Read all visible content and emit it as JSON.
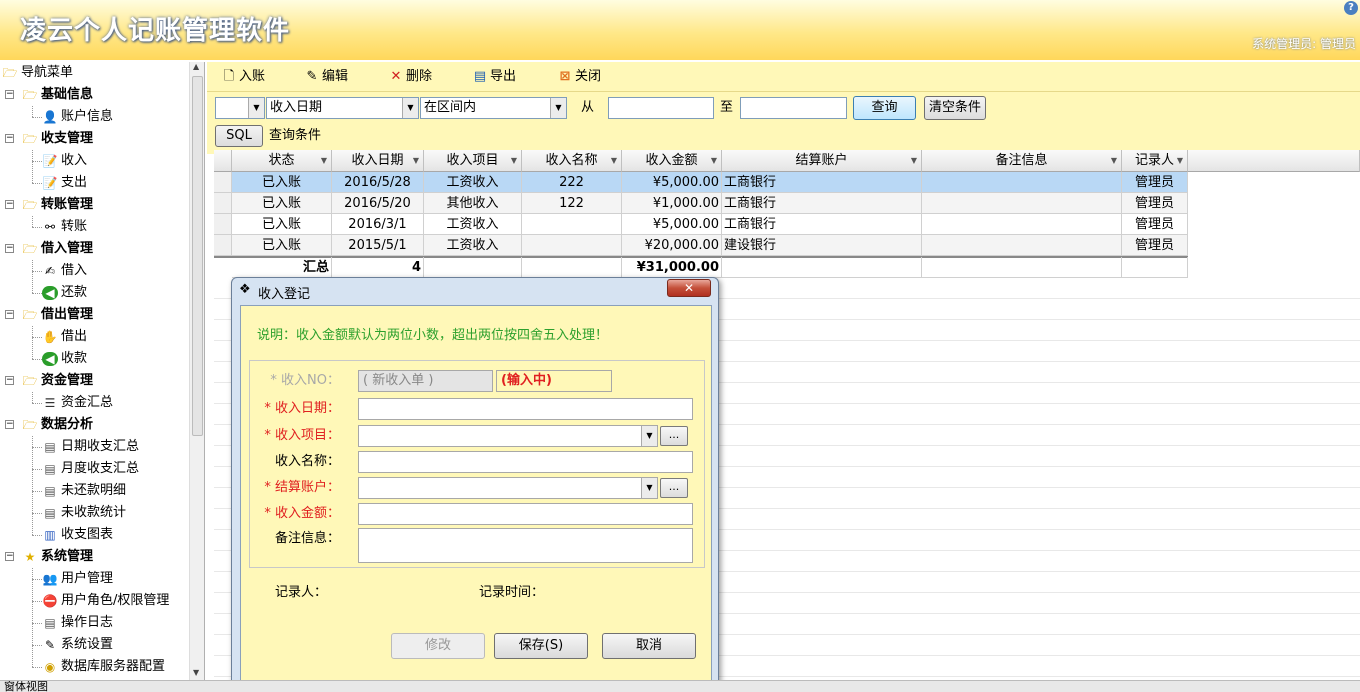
{
  "app": {
    "title": "凌云个人记账管理软件",
    "user_info": "系统管理员: 管理员",
    "help": "?"
  },
  "nav": {
    "root": "导航菜单",
    "groups": [
      {
        "label": "基础信息",
        "items": [
          "账户信息"
        ]
      },
      {
        "label": "收支管理",
        "items": [
          "收入",
          "支出"
        ]
      },
      {
        "label": "转账管理",
        "items": [
          "转账"
        ]
      },
      {
        "label": "借入管理",
        "items": [
          "借入",
          "还款"
        ]
      },
      {
        "label": "借出管理",
        "items": [
          "借出",
          "收款"
        ]
      },
      {
        "label": "资金管理",
        "items": [
          "资金汇总"
        ]
      },
      {
        "label": "数据分析",
        "items": [
          "日期收支汇总",
          "月度收支汇总",
          "未还款明细",
          "未收款统计",
          "收支图表"
        ]
      },
      {
        "label": "系统管理",
        "items": [
          "用户管理",
          "用户角色/权限管理",
          "操作日志",
          "系统设置",
          "数据库服务器配置"
        ]
      }
    ]
  },
  "toolbar": {
    "add": "入账",
    "edit": "编辑",
    "delete": "删除",
    "export": "导出",
    "close": "关闭"
  },
  "filter": {
    "field": "收入日期",
    "operator": "在区间内",
    "from_label": "从",
    "to_label": "至",
    "query": "查询",
    "clear": "清空条件",
    "sql": "SQL",
    "conditions": "查询条件"
  },
  "grid": {
    "columns": [
      "状态",
      "收入日期",
      "收入项目",
      "收入名称",
      "收入金额",
      "结算账户",
      "备注信息",
      "记录人"
    ],
    "rows": [
      [
        "已入账",
        "2016/5/28",
        "工资收入",
        "222",
        "¥5,000.00",
        "工商银行",
        "",
        "管理员"
      ],
      [
        "已入账",
        "2016/5/20",
        "其他收入",
        "122",
        "¥1,000.00",
        "工商银行",
        "",
        "管理员"
      ],
      [
        "已入账",
        "2016/3/1",
        "工资收入",
        "",
        "¥5,000.00",
        "工商银行",
        "",
        "管理员"
      ],
      [
        "已入账",
        "2015/5/1",
        "工资收入",
        "",
        "¥20,000.00",
        "建设银行",
        "",
        "管理员"
      ]
    ],
    "summary": {
      "label": "汇总",
      "count": "4",
      "total": "¥31,000.00"
    }
  },
  "dialog": {
    "title": "收入登记",
    "note": "说明：收入金额默认为两位小数，超出两位按四舍五入处理！",
    "no_label": "* 收入NO：",
    "no_value": "( 新收入单 )",
    "state": "(输入中)",
    "date_label": "* 收入日期：",
    "item_label": "* 收入项目：",
    "name_label": "收入名称：",
    "account_label": "* 结算账户：",
    "amount_label": "* 收入金额：",
    "remark_label": "备注信息：",
    "ellipsis": "...",
    "recorder_label": "记录人：",
    "time_label": "记录时间：",
    "modify": "修改",
    "save": "保存(S)",
    "cancel": "取消"
  },
  "status": {
    "text": "窗体视图"
  }
}
